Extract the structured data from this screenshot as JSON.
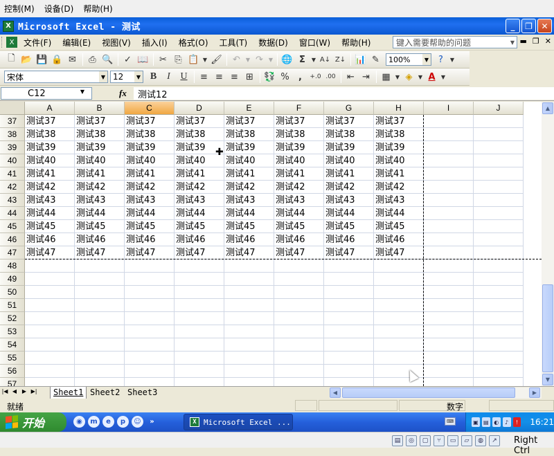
{
  "host_menu": [
    "控制(M)",
    "设备(D)",
    "帮助(H)"
  ],
  "window": {
    "title": "Microsoft Excel - 测试",
    "app_icon": "excel-icon",
    "controls": [
      "_",
      "❐",
      "✕"
    ]
  },
  "menubar": {
    "items": [
      "文件(F)",
      "编辑(E)",
      "视图(V)",
      "插入(I)",
      "格式(O)",
      "工具(T)",
      "数据(D)",
      "窗口(W)",
      "帮助(H)"
    ],
    "help_placeholder": "键入需要帮助的问题"
  },
  "toolbar_standard": {
    "buttons": [
      "new-icon",
      "open-icon",
      "save-icon",
      "permission-icon",
      "mail-icon",
      "print-icon",
      "print-preview-icon",
      "spelling-icon",
      "research-icon",
      "cut-icon",
      "copy-icon",
      "paste-icon",
      "format-painter-icon",
      "undo-icon",
      "redo-icon",
      "hyperlink-icon",
      "autosum-icon",
      "sort-asc-icon",
      "sort-desc-icon",
      "chart-wizard-icon",
      "drawing-icon",
      "help-icon"
    ],
    "zoom": "100%"
  },
  "toolbar_format": {
    "font": "宋体",
    "size": "12",
    "bold": "B",
    "italic": "I",
    "underline": "U",
    "percent": "%",
    "comma": ","
  },
  "formula_bar": {
    "name_box": "C12",
    "fx": "fx",
    "value": "测试12"
  },
  "grid": {
    "columns": [
      "A",
      "B",
      "C",
      "D",
      "E",
      "F",
      "G",
      "H",
      "I",
      "J"
    ],
    "active_column": "C",
    "data_columns": 8,
    "rows": [
      {
        "n": "37",
        "label": "测试37"
      },
      {
        "n": "38",
        "label": "测试38"
      },
      {
        "n": "39",
        "label": "测试39"
      },
      {
        "n": "40",
        "label": "测试40"
      },
      {
        "n": "41",
        "label": "测试41"
      },
      {
        "n": "42",
        "label": "测试42"
      },
      {
        "n": "43",
        "label": "测试43"
      },
      {
        "n": "44",
        "label": "测试44"
      },
      {
        "n": "45",
        "label": "测试45"
      },
      {
        "n": "46",
        "label": "测试46"
      },
      {
        "n": "47",
        "label": "测试47"
      },
      {
        "n": "48",
        "label": ""
      },
      {
        "n": "49",
        "label": ""
      },
      {
        "n": "50",
        "label": ""
      },
      {
        "n": "51",
        "label": ""
      },
      {
        "n": "52",
        "label": ""
      },
      {
        "n": "53",
        "label": ""
      },
      {
        "n": "54",
        "label": ""
      },
      {
        "n": "55",
        "label": ""
      },
      {
        "n": "56",
        "label": ""
      },
      {
        "n": "57",
        "label": ""
      }
    ]
  },
  "sheet_tabs": [
    "Sheet1",
    "Sheet2",
    "Sheet3"
  ],
  "active_sheet": "Sheet1",
  "statusbar": {
    "ready": "就绪",
    "num": "数字"
  },
  "taskbar": {
    "start": "开始",
    "task": "Microsoft Excel ...",
    "clock": "16:21"
  },
  "host_status": {
    "hostkey": "Right Ctrl"
  }
}
